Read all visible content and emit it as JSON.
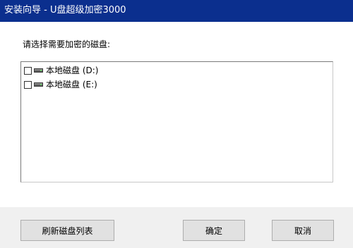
{
  "window": {
    "title": "安装向导 - U盘超级加密3000"
  },
  "main": {
    "prompt": "请选择需要加密的磁盘:",
    "drives": [
      {
        "label": "本地磁盘 (D:)",
        "checked": false,
        "icon": "hard-drive-icon"
      },
      {
        "label": "本地磁盘 (E:)",
        "checked": false,
        "icon": "hard-drive-icon"
      }
    ]
  },
  "footer": {
    "refresh_label": "刷新磁盘列表",
    "ok_label": "确定",
    "cancel_label": "取消"
  },
  "colors": {
    "titlebar": "#0b2f8e",
    "footer": "#f0f0f0",
    "button": "#e1e1e1"
  }
}
